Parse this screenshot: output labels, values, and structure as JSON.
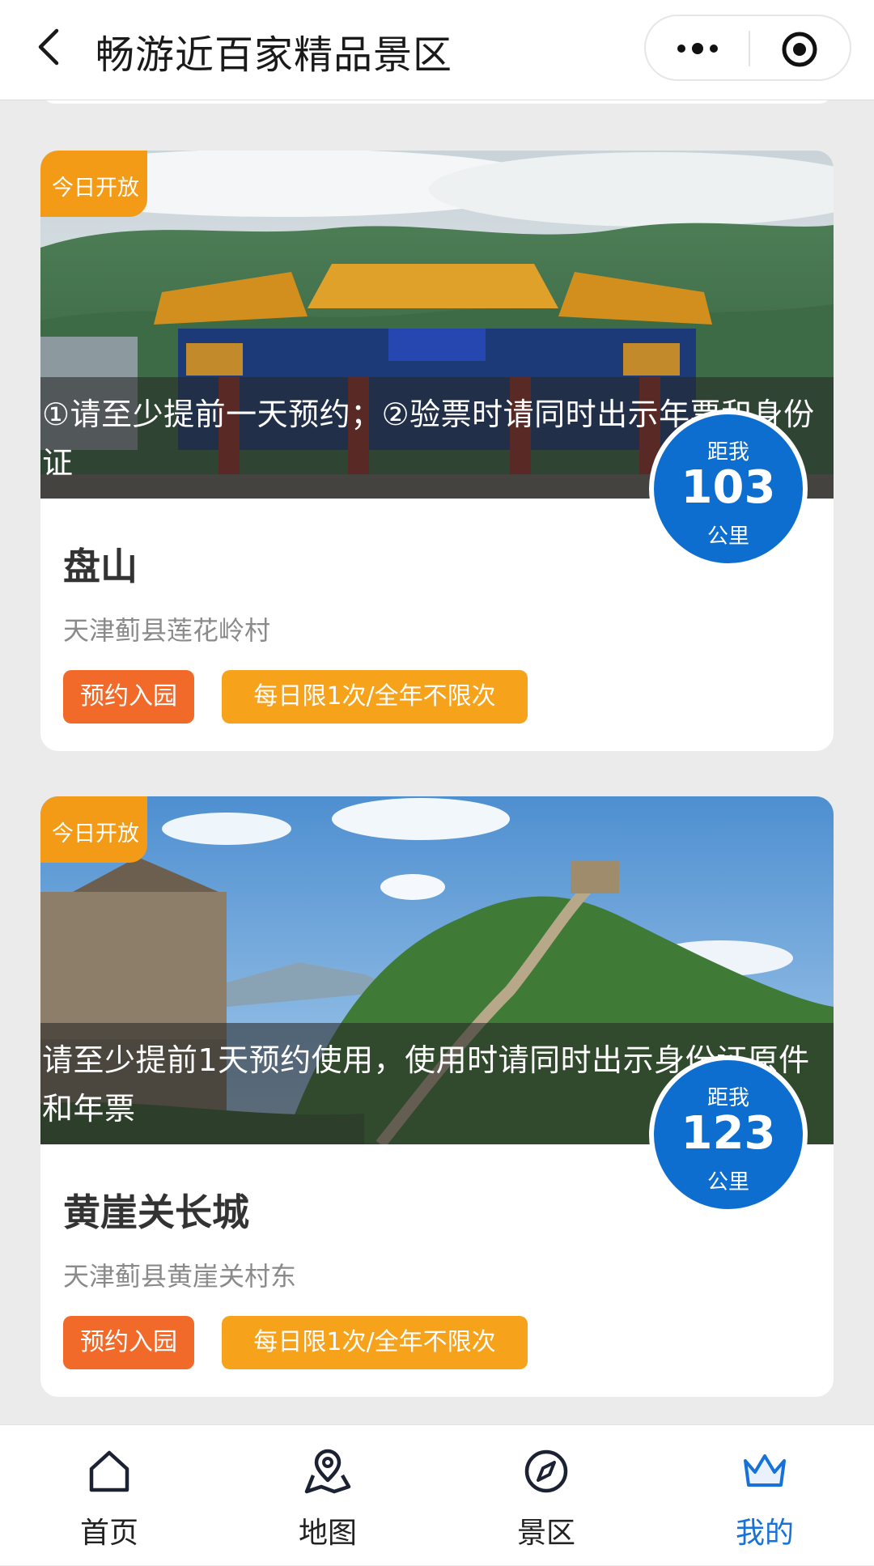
{
  "header": {
    "title": "畅游近百家精品景区"
  },
  "colors": {
    "accent_blue": "#0d6ed0",
    "badge_orange": "#f39a16",
    "tag_reserve": "#f26a2a",
    "tag_limit": "#f7a21b"
  },
  "cards": [
    {
      "status_badge": "今日开放",
      "notice": "①请至少提前一天预约；②验票时请同时出示年票和身份证",
      "distance": {
        "label_top": "距我",
        "value": "103",
        "unit": "公里"
      },
      "name": "盘山",
      "address": "天津蓟县莲花岭村",
      "tags": [
        "预约入园",
        "每日限1次/全年不限次"
      ]
    },
    {
      "status_badge": "今日开放",
      "notice": " 请至少提前1天预约使用，使用时请同时出示身份证原件和年票",
      "distance": {
        "label_top": "距我",
        "value": "123",
        "unit": "公里"
      },
      "name": "黄崖关长城",
      "address": "天津蓟县黄崖关村东",
      "tags": [
        "预约入园",
        "每日限1次/全年不限次"
      ]
    }
  ],
  "tabbar": {
    "items": [
      {
        "label": "首页",
        "icon": "home-icon"
      },
      {
        "label": "地图",
        "icon": "map-pin-icon"
      },
      {
        "label": "景区",
        "icon": "compass-icon"
      },
      {
        "label": "我的",
        "icon": "crown-icon",
        "active": true
      }
    ]
  }
}
